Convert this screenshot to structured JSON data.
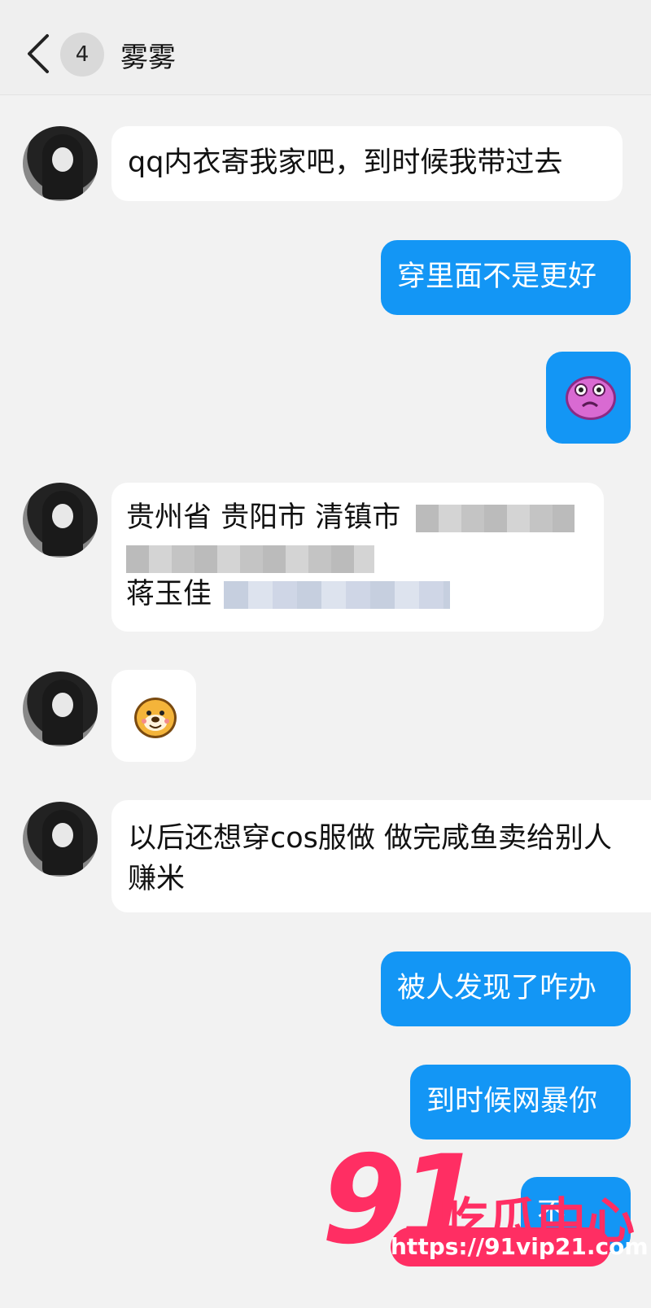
{
  "header": {
    "back_icon": "chevron-left-icon",
    "unread_count": "4",
    "contact_name": "雾雾"
  },
  "colors": {
    "outgoing_bubble": "#1396f5",
    "incoming_bubble": "#ffffff",
    "background": "#f2f2f2",
    "watermark": "#ff2e63"
  },
  "messages": [
    {
      "direction": "in",
      "text": "qq内衣寄我家吧，到时候我带过去"
    },
    {
      "direction": "out",
      "text": "穿里面不是更好"
    },
    {
      "direction": "out",
      "sticker": "pink-frog-sticker"
    },
    {
      "direction": "in",
      "address_line1": "贵州省 贵阳市 清镇市",
      "name_line": "蒋玉佳"
    },
    {
      "direction": "in",
      "sticker": "dog-face-sticker"
    },
    {
      "direction": "in",
      "text": "以后还想穿cos服做 做完咸鱼卖给别人赚米"
    },
    {
      "direction": "out",
      "text": "被人发现了咋办"
    },
    {
      "direction": "out",
      "text": "到时候网暴你"
    },
    {
      "direction": "out",
      "text": "不"
    }
  ],
  "watermark": {
    "number": "91",
    "label": "吃瓜中心",
    "url": "https://91vip21.com"
  }
}
